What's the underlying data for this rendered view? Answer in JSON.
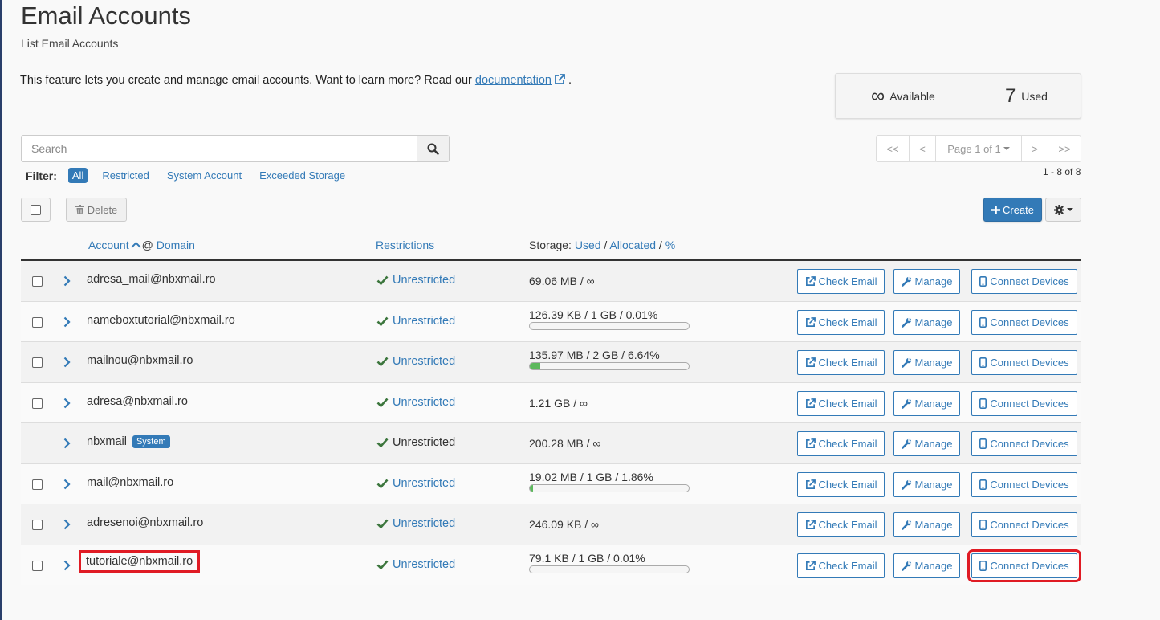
{
  "header": {
    "title": "Email Accounts",
    "subtitle": "List Email Accounts",
    "intro_before": "This feature lets you create and manage email accounts. Want to learn more? Read our ",
    "intro_link": "documentation",
    "intro_after": "."
  },
  "stats": {
    "available_value": "∞",
    "available_label": "Available",
    "used_value": "7",
    "used_label": "Used"
  },
  "search": {
    "placeholder": "Search"
  },
  "filter": {
    "label": "Filter:",
    "options": [
      "All",
      "Restricted",
      "System Account",
      "Exceeded Storage"
    ],
    "active": "All"
  },
  "pager": {
    "first": "<<",
    "prev": "<",
    "page": "Page 1 of 1",
    "next": ">",
    "last": ">>",
    "range": "1 - 8 of 8"
  },
  "toolbar": {
    "delete_label": "Delete",
    "create_label": "Create"
  },
  "table": {
    "headers": {
      "account": "Account",
      "at": "@",
      "domain": "Domain",
      "restrictions": "Restrictions",
      "storage_prefix": "Storage: ",
      "storage_used": "Used",
      "storage_allocated": "Allocated",
      "storage_percent": "%",
      "sep": " / "
    },
    "rows": [
      {
        "account": "adresa_mail@nbxmail.ro",
        "restriction": "Unrestricted",
        "storage": "69.06 MB / ∞",
        "usage_percent": null,
        "system": false,
        "highlight_account": false,
        "highlight_connect": false
      },
      {
        "account": "nameboxtutorial@nbxmail.ro",
        "restriction": "Unrestricted",
        "storage": "126.39 KB / 1 GB / 0.01%",
        "usage_percent": 0.01,
        "system": false,
        "highlight_account": false,
        "highlight_connect": false
      },
      {
        "account": "mailnou@nbxmail.ro",
        "restriction": "Unrestricted",
        "storage": "135.97 MB / 2 GB / 6.64%",
        "usage_percent": 6.64,
        "system": false,
        "highlight_account": false,
        "highlight_connect": false
      },
      {
        "account": "adresa@nbxmail.ro",
        "restriction": "Unrestricted",
        "storage": "1.21 GB / ∞",
        "usage_percent": null,
        "system": false,
        "highlight_account": false,
        "highlight_connect": false
      },
      {
        "account": "nbxmail",
        "badge": "System",
        "restriction": "Unrestricted",
        "storage": "200.28 MB / ∞",
        "usage_percent": null,
        "system": true,
        "highlight_account": false,
        "highlight_connect": false
      },
      {
        "account": "mail@nbxmail.ro",
        "restriction": "Unrestricted",
        "storage": "19.02 MB / 1 GB / 1.86%",
        "usage_percent": 1.86,
        "system": false,
        "highlight_account": false,
        "highlight_connect": false
      },
      {
        "account": "adresenoi@nbxmail.ro",
        "restriction": "Unrestricted",
        "storage": "246.09 KB / ∞",
        "usage_percent": null,
        "system": false,
        "highlight_account": false,
        "highlight_connect": false
      },
      {
        "account": "tutoriale@nbxmail.ro",
        "restriction": "Unrestricted",
        "storage": "79.1 KB / 1 GB / 0.01%",
        "usage_percent": 0.01,
        "system": false,
        "highlight_account": true,
        "highlight_connect": true
      }
    ],
    "actions": {
      "check": "Check Email",
      "manage": "Manage",
      "connect": "Connect Devices"
    }
  },
  "colors": {
    "accent": "#337ab7",
    "success": "#5cb85c",
    "check_green": "#3c763d",
    "highlight": "#e01b24"
  }
}
